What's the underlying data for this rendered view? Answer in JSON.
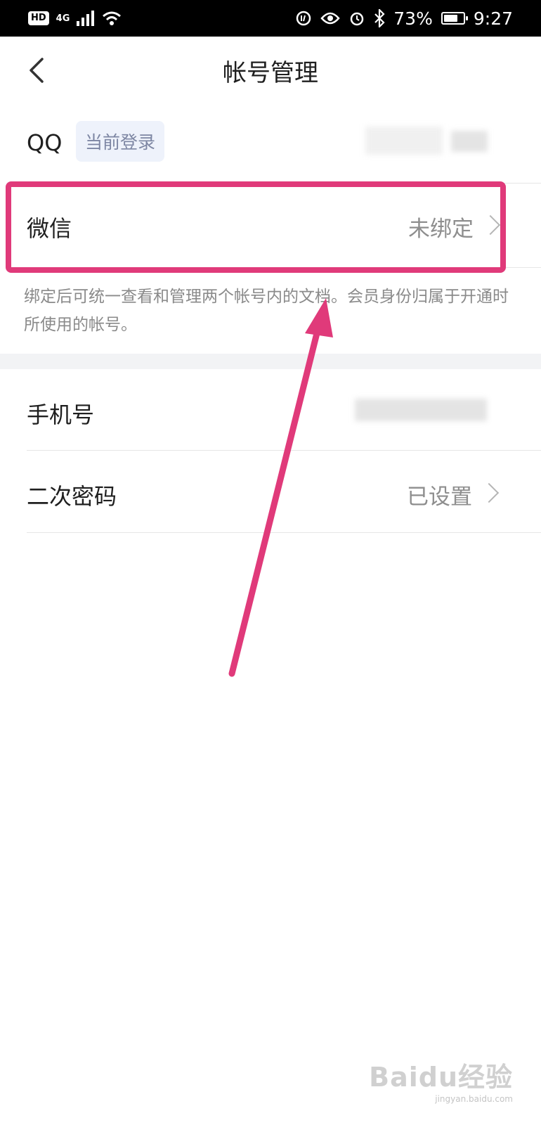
{
  "status_bar": {
    "hd": "HD",
    "network": "4G",
    "battery": "73%",
    "time": "9:27",
    "battery_level": 0.73
  },
  "nav": {
    "title": "帐号管理"
  },
  "accounts": {
    "qq": {
      "label": "QQ",
      "badge": "当前登录"
    },
    "wechat": {
      "label": "微信",
      "value": "未绑定"
    },
    "hint": "绑定后可统一查看和管理两个帐号内的文档。会员身份归属于开通时所使用的帐号。"
  },
  "security": {
    "phone": {
      "label": "手机号"
    },
    "second_password": {
      "label": "二次密码",
      "value": "已设置"
    }
  },
  "annotation": {
    "color": "#e03a7a"
  },
  "watermark": {
    "brand": "Baidu经验",
    "url": "jingyan.baidu.com"
  }
}
